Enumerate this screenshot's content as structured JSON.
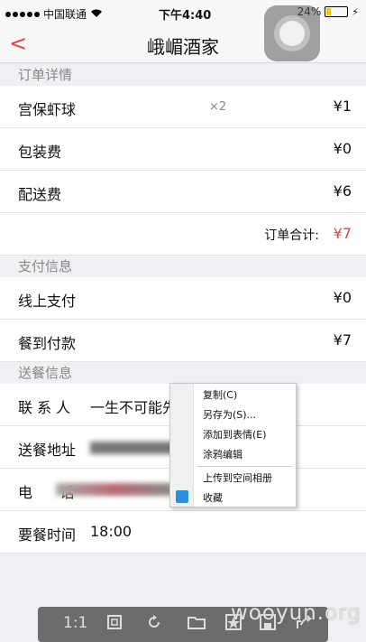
{
  "status_bar": {
    "carrier": "中国联通",
    "time": "下午4:40",
    "battery": "24%",
    "battery_level": 0.24
  },
  "nav": {
    "title": "峨嵋酒家"
  },
  "order": {
    "section_title": "订单详情",
    "items": [
      {
        "name": "宫保虾球",
        "qty": "×2",
        "amount": "¥1"
      },
      {
        "name": "包装费",
        "qty": "",
        "amount": "¥0"
      },
      {
        "name": "配送费",
        "qty": "",
        "amount": "¥6"
      }
    ],
    "total_label": "订单合计:",
    "total_amount": "¥7"
  },
  "payment": {
    "section_title": "支付信息",
    "online_label": "线上支付",
    "online_amount": "¥0",
    "cash_label": "餐到付款",
    "cash_amount": "¥7"
  },
  "delivery": {
    "section_title": "送餐信息",
    "contact_label": "联 系 人",
    "contact_value": "一生不可能先生",
    "address_label": "送餐地址",
    "phone_label": "电      话",
    "time_label": "要餐时间",
    "time_value": "18:00"
  },
  "context_menu": {
    "items": [
      "复制(C)",
      "另存为(S)...",
      "添加到表情(E)",
      "涂鸦编辑",
      "上传到空间相册",
      "收藏"
    ]
  },
  "toolbar": {
    "zoom_label": "1:1"
  },
  "watermark": "wooyun.org"
}
